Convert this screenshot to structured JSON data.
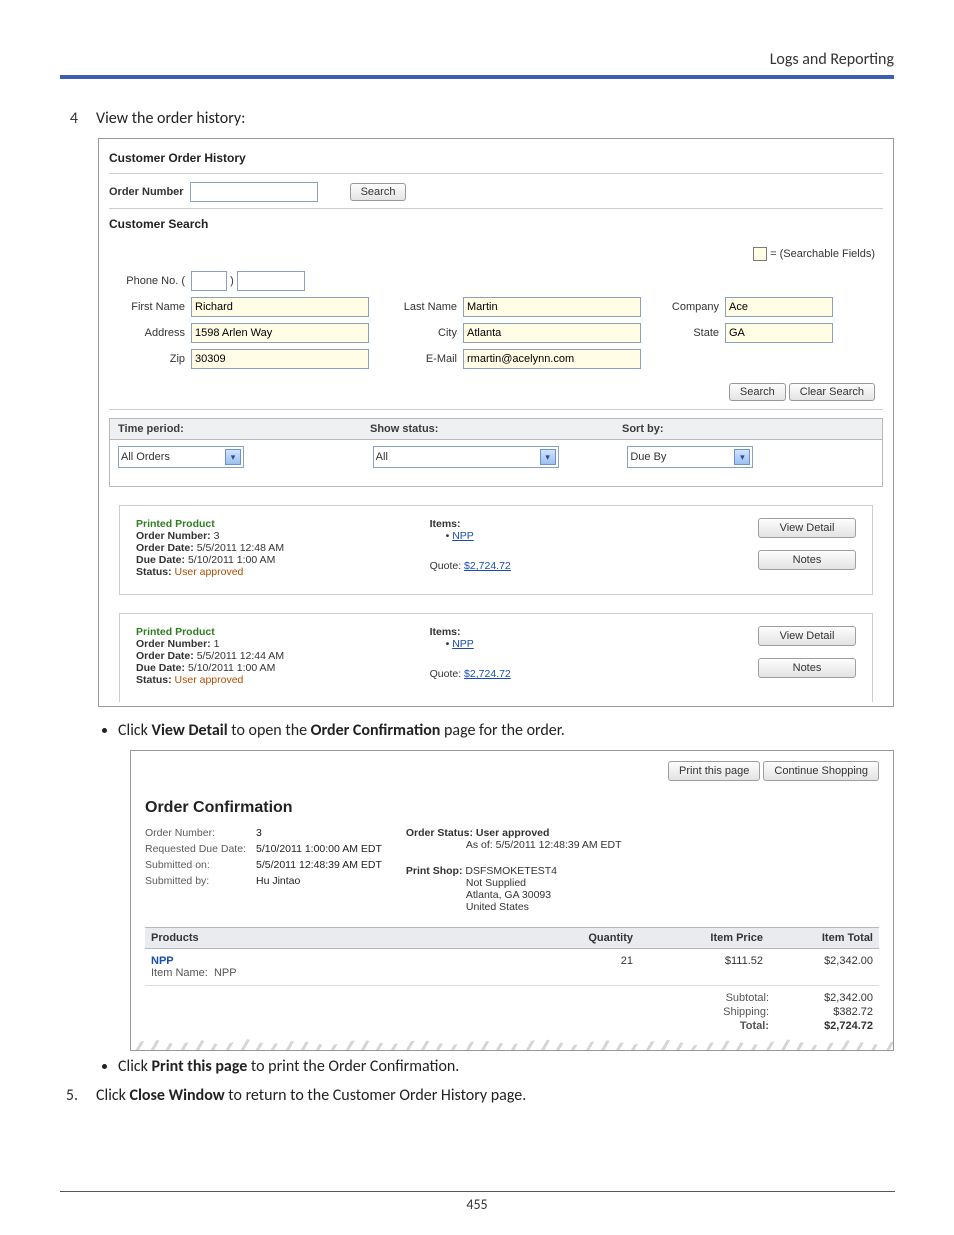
{
  "header": {
    "section": "Logs and Reporting"
  },
  "step4": {
    "num": "4",
    "text": "View the order history:"
  },
  "history": {
    "title": "Customer Order History",
    "order_number_label": "Order Number",
    "search_btn": "Search",
    "search_title": "Customer Search",
    "legend": "= (Searchable Fields)",
    "fields": {
      "phone_label": "Phone No. (",
      "phone_paren_close": ")",
      "first_name_label": "First Name",
      "first_name": "Richard",
      "last_name_label": "Last Name",
      "last_name": "Martin",
      "company_label": "Company",
      "company": "Ace",
      "address_label": "Address",
      "address": "1598 Arlen Way",
      "city_label": "City",
      "city": "Atlanta",
      "state_label": "State",
      "state": "GA",
      "zip_label": "Zip",
      "zip": "30309",
      "email_label": "E-Mail",
      "email": "rmartin@acelynn.com"
    },
    "search2_btn": "Search",
    "clear_btn": "Clear Search",
    "filters": {
      "time_label": "Time period:",
      "time_value": "All Orders",
      "status_label": "Show status:",
      "status_value": "All",
      "sort_label": "Sort by:",
      "sort_value": "Due By"
    },
    "cards": [
      {
        "type": "Printed Product",
        "onum_lbl": "Order Number:",
        "onum": "3",
        "odate_lbl": "Order Date:",
        "odate": "5/5/2011 12:48 AM",
        "ddate_lbl": "Due Date:",
        "ddate": "5/10/2011 1:00 AM",
        "status_lbl": "Status:",
        "status": "User approved",
        "items_lbl": "Items:",
        "item": "NPP",
        "quote_lbl": "Quote:",
        "quote": "$2,724.72",
        "view_btn": "View Detail",
        "notes_btn": "Notes"
      },
      {
        "type": "Printed Product",
        "onum_lbl": "Order Number:",
        "onum": "1",
        "odate_lbl": "Order Date:",
        "odate": "5/5/2011 12:44 AM",
        "ddate_lbl": "Due Date:",
        "ddate": "5/10/2011 1:00 AM",
        "status_lbl": "Status:",
        "status": "User approved",
        "items_lbl": "Items:",
        "item": "NPP",
        "quote_lbl": "Quote:",
        "quote": "$2,724.72",
        "view_btn": "View Detail",
        "notes_btn": "Notes"
      }
    ]
  },
  "bullet1_a": "Click ",
  "bullet1_b": "View Detail",
  "bullet1_c": " to open the ",
  "bullet1_d": "Order Confirmation",
  "bullet1_e": " page for the order.",
  "confirm": {
    "print_btn": "Print this page",
    "continue_btn": "Continue Shopping",
    "title": "Order Confirmation",
    "left": {
      "onum_lbl": "Order Number:",
      "onum": "3",
      "req_lbl": "Requested Due Date:",
      "req": "5/10/2011 1:00:00 AM EDT",
      "sub_on_lbl": "Submitted on:",
      "sub_on": "5/5/2011 12:48:39 AM EDT",
      "sub_by_lbl": "Submitted by:",
      "sub_by": "Hu Jintao"
    },
    "right": {
      "status_lbl": "Order Status: User approved",
      "asof_lbl": "As of:",
      "asof": "5/5/2011 12:48:39 AM EDT",
      "ps_lbl": "Print Shop:",
      "ps1": "DSFSMOKETEST4",
      "ps2": "Not Supplied",
      "ps3": "Atlanta, GA 30093",
      "ps4": "United States"
    },
    "tbl": {
      "h1": "Products",
      "h2": "Quantity",
      "h3": "Item Price",
      "h4": "Item Total",
      "p_name": "NPP",
      "p_sub_lbl": "Item Name:",
      "p_sub": "NPP",
      "qty": "21",
      "price": "$111.52",
      "total": "$2,342.00"
    },
    "totals": {
      "sub_lbl": "Subtotal:",
      "sub": "$2,342.00",
      "ship_lbl": "Shipping:",
      "ship": "$382.72",
      "tot_lbl": "Total:",
      "tot": "$2,724.72"
    }
  },
  "bullet2_a": "Click ",
  "bullet2_b": "Print this page",
  "bullet2_c": " to print the Order Confirmation.",
  "step5": {
    "num": "5.",
    "a": "Click ",
    "b": "Close Window",
    "c": " to return to the Customer Order History page."
  },
  "page_number": "455"
}
